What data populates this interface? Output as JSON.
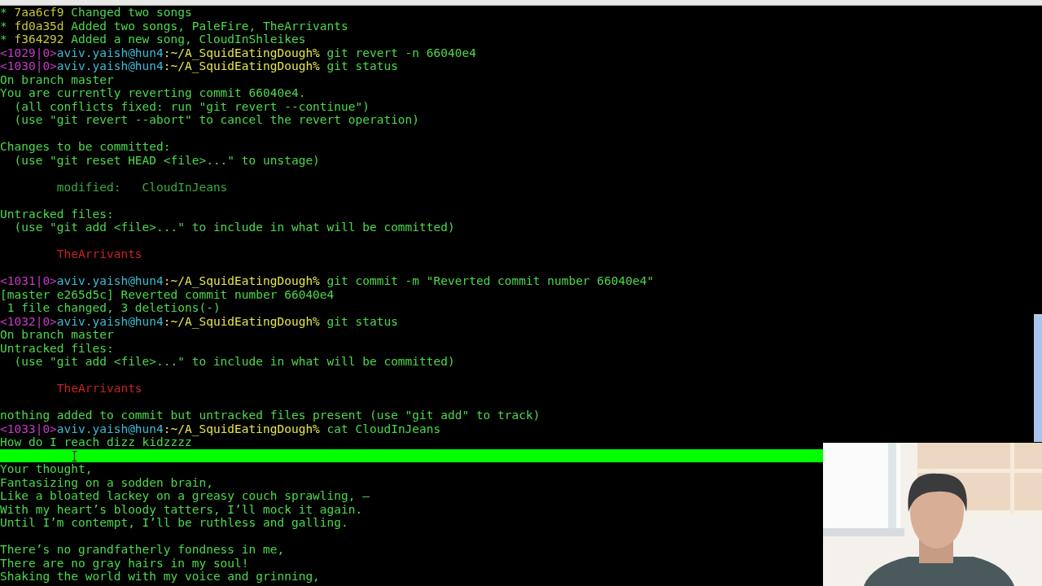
{
  "terminal": {
    "lines": [
      {
        "kind": "log",
        "mark": "*",
        "hash": "7aa6cf9",
        "message": "Changed two songs"
      },
      {
        "kind": "log",
        "mark": "*",
        "hash": "fd0a35d",
        "message": "Added two songs, PaleFire, TheArrivants"
      },
      {
        "kind": "log",
        "mark": "*",
        "hash": "f364292",
        "message": "Added a new song, CloudInShleikes"
      },
      {
        "kind": "prompt",
        "number": "<1029|0>",
        "user": "aviv.yaish@hun4",
        "path": ":~/A_SquidEatingDough%",
        "command": "git revert -n 66040e4"
      },
      {
        "kind": "prompt",
        "number": "<1030|0>",
        "user": "aviv.yaish@hun4",
        "path": ":~/A_SquidEatingDough%",
        "command": "git status"
      },
      {
        "kind": "text",
        "color": "#4cd84c",
        "text": "On branch master"
      },
      {
        "kind": "text",
        "color": "#4cd84c",
        "text": "You are currently reverting commit 66040e4."
      },
      {
        "kind": "text",
        "color": "#4cd84c",
        "text": "  (all conflicts fixed: run \"git revert --continue\")"
      },
      {
        "kind": "text",
        "color": "#4cd84c",
        "text": "  (use \"git revert --abort\" to cancel the revert operation)"
      },
      {
        "kind": "blank"
      },
      {
        "kind": "text",
        "color": "#4cd84c",
        "text": "Changes to be committed:"
      },
      {
        "kind": "text",
        "color": "#4cd84c",
        "text": "  (use \"git reset HEAD <file>...\" to unstage)"
      },
      {
        "kind": "blank"
      },
      {
        "kind": "text",
        "color": "#3aaa3a",
        "text": "        modified:   CloudInJeans"
      },
      {
        "kind": "blank"
      },
      {
        "kind": "text",
        "color": "#4cd84c",
        "text": "Untracked files:"
      },
      {
        "kind": "text",
        "color": "#4cd84c",
        "text": "  (use \"git add <file>...\" to include in what will be committed)"
      },
      {
        "kind": "blank"
      },
      {
        "kind": "text",
        "color": "#c82222",
        "text": "        TheArrivants"
      },
      {
        "kind": "blank"
      },
      {
        "kind": "prompt",
        "number": "<1031|0>",
        "user": "aviv.yaish@hun4",
        "path": ":~/A_SquidEatingDough%",
        "command": "git commit -m \"Reverted commit number 66040e4\""
      },
      {
        "kind": "text",
        "color": "#4cd84c",
        "text": "[master e265d5c] Reverted commit number 66040e4"
      },
      {
        "kind": "text",
        "color": "#4cd84c",
        "text": " 1 file changed, 3 deletions(-)"
      },
      {
        "kind": "prompt",
        "number": "<1032|0>",
        "user": "aviv.yaish@hun4",
        "path": ":~/A_SquidEatingDough%",
        "command": "git status"
      },
      {
        "kind": "text",
        "color": "#4cd84c",
        "text": "On branch master"
      },
      {
        "kind": "text",
        "color": "#4cd84c",
        "text": "Untracked files:"
      },
      {
        "kind": "text",
        "color": "#4cd84c",
        "text": "  (use \"git add <file>...\" to include in what will be committed)"
      },
      {
        "kind": "blank"
      },
      {
        "kind": "text",
        "color": "#c82222",
        "text": "        TheArrivants"
      },
      {
        "kind": "blank"
      },
      {
        "kind": "text",
        "color": "#4cd84c",
        "text": "nothing added to commit but untracked files present (use \"git add\" to track)"
      },
      {
        "kind": "prompt",
        "number": "<1033|0>",
        "user": "aviv.yaish@hun4",
        "path": ":~/A_SquidEatingDough%",
        "command": "cat CloudInJeans"
      },
      {
        "kind": "text",
        "color": "#4cd84c",
        "text": "How do I reach dizz kidzzzz"
      },
      {
        "kind": "highlight"
      },
      {
        "kind": "text",
        "color": "#4cd84c",
        "text": "Your thought,"
      },
      {
        "kind": "text",
        "color": "#4cd84c",
        "text": "Fantasizing on a sodden brain,"
      },
      {
        "kind": "text",
        "color": "#4cd84c",
        "text": "Like a bloated lackey on a greasy couch sprawling, —"
      },
      {
        "kind": "text",
        "color": "#4cd84c",
        "text": "With my heart’s bloody tatters, I’ll mock it again."
      },
      {
        "kind": "text",
        "color": "#4cd84c",
        "text": "Until I’m contempt, I’ll be ruthless and galling."
      },
      {
        "kind": "blank"
      },
      {
        "kind": "text",
        "color": "#4cd84c",
        "text": "There’s no grandfatherly fondness in me,"
      },
      {
        "kind": "text",
        "color": "#4cd84c",
        "text": "There are no gray hairs in my soul!"
      },
      {
        "kind": "text",
        "color": "#4cd84c",
        "text": "Shaking the world with my voice and grinning,"
      }
    ]
  }
}
